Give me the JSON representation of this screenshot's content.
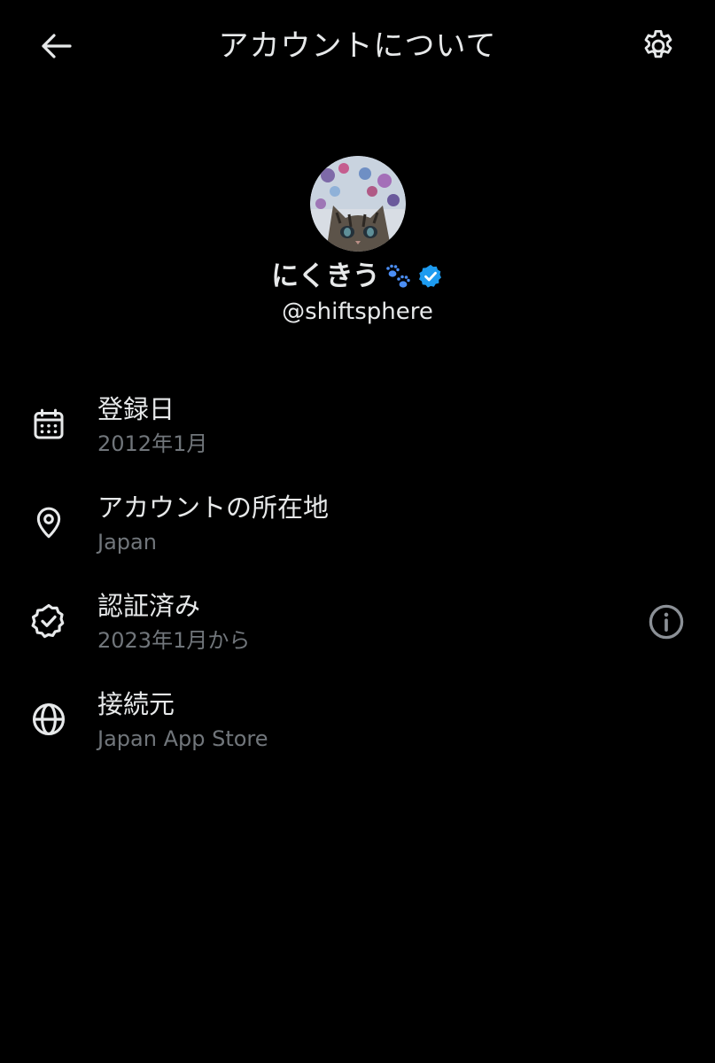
{
  "header": {
    "title": "アカウントについて",
    "back_icon": "arrow-left-icon",
    "settings_icon": "gear-icon"
  },
  "profile": {
    "display_name": "にくきう",
    "name_emoji_icon": "paw-prints-icon",
    "verified_icon": "verified-badge-icon",
    "handle": "@shiftsphere"
  },
  "rows": [
    {
      "icon": "calendar-icon",
      "label": "登録日",
      "value": "2012年1月"
    },
    {
      "icon": "location-pin-icon",
      "label": "アカウントの所在地",
      "value": "Japan"
    },
    {
      "icon": "verified-outline-icon",
      "label": "認証済み",
      "value": "2023年1月から",
      "action_icon": "info-icon"
    },
    {
      "icon": "globe-icon",
      "label": "接続元",
      "value": "Japan App Store"
    }
  ],
  "colors": {
    "background": "#000000",
    "primary_text": "#e7e9ea",
    "secondary_text": "#71767b",
    "verified_blue": "#1d9bf0"
  }
}
